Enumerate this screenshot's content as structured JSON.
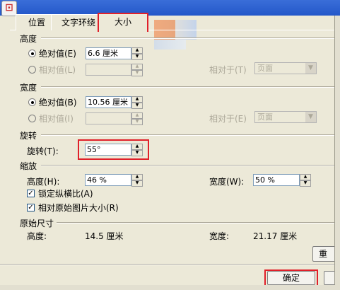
{
  "tabs": [
    {
      "label": "位置"
    },
    {
      "label": "文字环绕"
    },
    {
      "label": "大小"
    }
  ],
  "height_group": {
    "title": "高度",
    "absolute_label": "绝对值(E)",
    "absolute_value": "6.6 厘米",
    "relative_label": "相对值(L)",
    "relative_to_label": "相对于(T)",
    "relative_to_value": "页面"
  },
  "width_group": {
    "title": "宽度",
    "absolute_label": "绝对值(B)",
    "absolute_value": "10.56 厘米",
    "relative_label": "相对值(I)",
    "relative_to_label": "相对于(E)",
    "relative_to_value": "页面"
  },
  "rotation_group": {
    "title": "旋转",
    "rotation_label": "旋转(T):",
    "rotation_value": "55°"
  },
  "scale_group": {
    "title": "缩放",
    "height_label": "高度(H):",
    "height_value": "46 %",
    "width_label": "宽度(W):",
    "width_value": "50 %",
    "lock_ratio_label": "锁定纵横比(A)",
    "lock_ratio_checked": true,
    "relative_original_label": "相对原始图片大小(R)",
    "relative_original_checked": true
  },
  "original_size_group": {
    "title": "原始尺寸",
    "height_label": "高度:",
    "height_value": "14.5 厘米",
    "width_label": "宽度:",
    "width_value": "21.17 厘米"
  },
  "buttons": {
    "reset_partial": "重",
    "ok": "确定"
  },
  "icons": {
    "window_icon": "app-logo-icon",
    "spin_up": "▲",
    "spin_down": "▼",
    "dropdown": "▼",
    "check_mark": "✓"
  },
  "colors": {
    "highlight_box": "#e0202a",
    "dialog_bg": "#ece9d8",
    "titlebar": "#2357c9"
  }
}
